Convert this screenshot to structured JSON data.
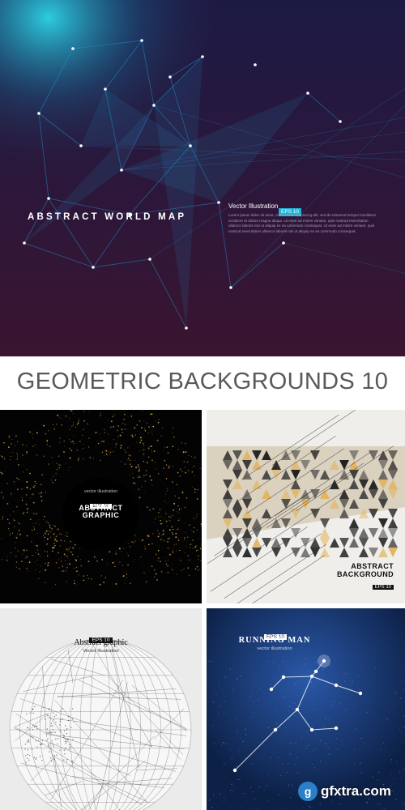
{
  "hero": {
    "title": "ABSTRACT WORLD MAP",
    "vector_label": "Vector Illustration",
    "badge": "EPS 10",
    "body": "Lorem ipsum dolor sit amet, consectetur adipiscing elit, sed do eiusmod tempor incididunt ut labore et dolore magna aliqua. Ut enim ad minim veniam, quis nostrud exercitation ullamco laboris nisi ut aliquip ex ea commodo consequat. Ut enim ad minim veniam, quis nostrud exercitation ullamco laboris nisi ut aliquip ex ea commodo consequat.",
    "colors": {
      "background": "#2b1638",
      "network": "#1e9ad6",
      "glow": "#2ee0f0"
    }
  },
  "main_title": "GEOMETRIC BACKGROUNDS 10",
  "thumbnails": [
    {
      "vector_label": "vector illustration",
      "badge": "EPS 10",
      "title_line1": "ABSTRACT",
      "title_line2": "GRAPHIC",
      "colors": {
        "background": "#030303",
        "particles": "#d4a24a"
      }
    },
    {
      "title_line1": "ABSTRACT",
      "title_line2": "BACKGROUND",
      "badge": "EPS 10",
      "colors": {
        "background": "#efeeeb",
        "triangles": "#3a3a3a",
        "accent": "#c8b99a"
      }
    },
    {
      "badge": "EPS 10",
      "title": "Abstract graphic",
      "subtitle": "Vector Illustration",
      "colors": {
        "background": "#ebebeb",
        "lines": "#222222"
      }
    },
    {
      "badge": "EPS 10",
      "title": "RUNNING MAN",
      "subtitle": "vector illustration",
      "colors": {
        "background": "#0d2147",
        "figure": "#ffffff"
      }
    }
  ],
  "watermark": {
    "icon_label": "g",
    "text": "gfxtra.com",
    "icon_name": "gfxtra-logo-icon"
  }
}
